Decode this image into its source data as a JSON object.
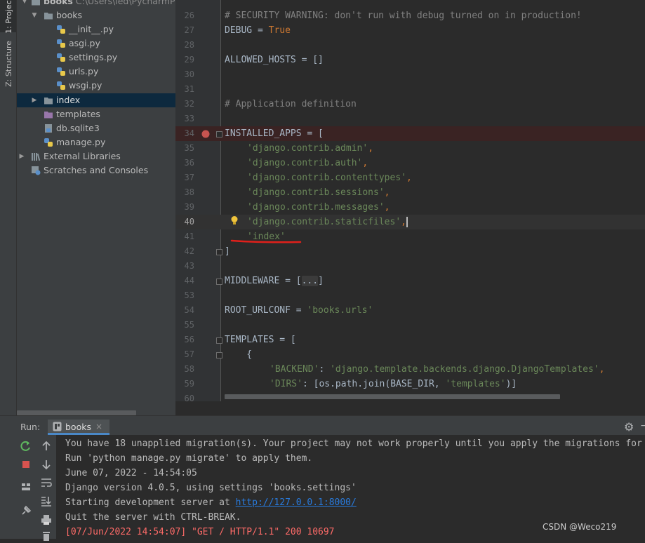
{
  "side_tabs": {
    "project": "1: Project",
    "structure": "Z: Structure"
  },
  "project_tree": {
    "root": {
      "name": "books",
      "path": "C:\\Users\\ied\\PycharmPro"
    },
    "items": [
      {
        "label": "books",
        "icon": "folder-icon"
      },
      {
        "label": "__init__.py",
        "icon": "python-file-icon"
      },
      {
        "label": "asgi.py",
        "icon": "python-file-icon"
      },
      {
        "label": "settings.py",
        "icon": "python-file-icon"
      },
      {
        "label": "urls.py",
        "icon": "python-file-icon"
      },
      {
        "label": "wsgi.py",
        "icon": "python-file-icon"
      },
      {
        "label": "index",
        "icon": "folder-icon"
      },
      {
        "label": "templates",
        "icon": "folder-icon"
      },
      {
        "label": "db.sqlite3",
        "icon": "database-file-icon"
      },
      {
        "label": "manage.py",
        "icon": "python-file-icon"
      },
      {
        "label": "External Libraries",
        "icon": "library-icon"
      },
      {
        "label": "Scratches and Consoles",
        "icon": "scratches-icon"
      }
    ]
  },
  "editor": {
    "line_numbers": [
      "26",
      "27",
      "28",
      "29",
      "30",
      "31",
      "32",
      "33",
      "34",
      "35",
      "36",
      "37",
      "38",
      "39",
      "40",
      "41",
      "42",
      "43",
      "44",
      "53",
      "54",
      "55",
      "56",
      "57",
      "58",
      "59",
      "60"
    ],
    "l26": "# SECURITY WARNING: don't run with debug turned on in production!",
    "l27_name": "DEBUG = ",
    "l27_val": "True",
    "l29": "ALLOWED_HOSTS = []",
    "l32": "# Application definition",
    "l34": "INSTALLED_APPS = [",
    "apps": [
      "'django.contrib.admin'",
      "'django.contrib.auth'",
      "'django.contrib.contenttypes'",
      "'django.contrib.sessions'",
      "'django.contrib.messages'",
      "'django.contrib.staticfiles'",
      "'index'"
    ],
    "comma": ",",
    "l42": "]",
    "l44_a": "MIDDLEWARE = [",
    "l44_b": "...",
    "l44_c": "]",
    "l54_a": "ROOT_URLCONF = ",
    "l54_b": "'books.urls'",
    "l56": "TEMPLATES = [",
    "l57": "    {",
    "l58_k": "'BACKEND'",
    "l58_sep": ": ",
    "l58_v": "'django.template.backends.django.DjangoTemplates'",
    "l59_k": "'DIRS'",
    "l59_sep": ": [os.path.join(BASE_DIR, ",
    "l59_v": "'templates'",
    "l59_end": ")]"
  },
  "run_panel": {
    "label": "Run:",
    "tab": "books",
    "close": "×",
    "console": [
      "You have 18 unapplied migration(s). Your project may not work properly until you apply the migrations for",
      "Run 'python manage.py migrate' to apply them.",
      "June 07, 2022 - 14:54:05",
      "Django version 4.0.5, using settings 'books.settings'"
    ],
    "server_prefix": "Starting development server at ",
    "server_url": "http://127.0.0.1:8000/",
    "quit_line": "Quit the server with CTRL-BREAK.",
    "request_line": "[07/Jun/2022 14:54:07] \"GET / HTTP/1.1\" 200 10697"
  },
  "watermark": "CSDN @Weco219",
  "colors": {
    "keyword": "#cc7832",
    "string": "#6a8759",
    "comment": "#808080",
    "error": "#ff6b68",
    "annotation": "#e0201b"
  }
}
